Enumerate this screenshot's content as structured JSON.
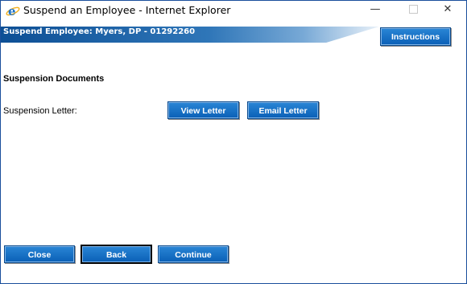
{
  "window": {
    "title": "Suspend an Employee - Internet Explorer",
    "controls": {
      "minimize": "—",
      "maximize": "",
      "close": "✕"
    }
  },
  "header": {
    "title": "Suspend Employee: Myers, DP - 01292260",
    "instructions_label": "Instructions"
  },
  "section": {
    "title": "Suspension Documents",
    "letter_label": "Suspension Letter:",
    "view_letter_label": "View Letter",
    "email_letter_label": "Email Letter"
  },
  "footer": {
    "close_label": "Close",
    "back_label": "Back",
    "continue_label": "Continue"
  },
  "colors": {
    "button_top": "#2a86d6",
    "button_bottom": "#0a5fb6",
    "header_band": "#0d4f95",
    "window_border": "#1a4f9c"
  }
}
